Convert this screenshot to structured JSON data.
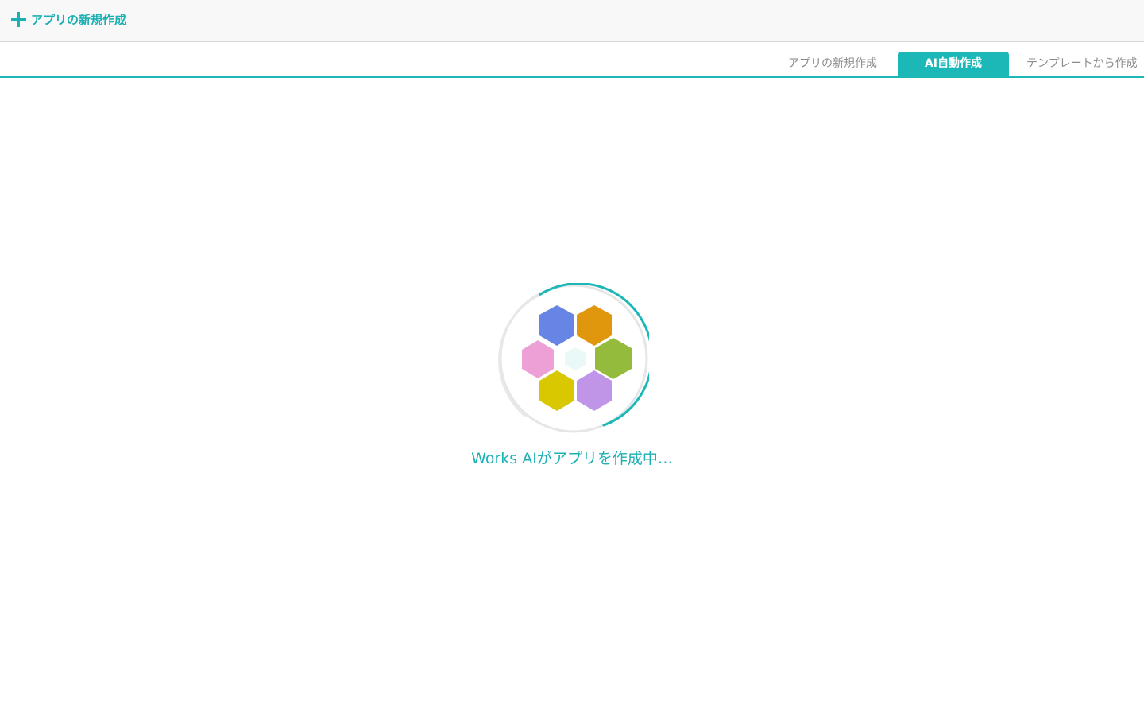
{
  "header": {
    "title": "アプリの新規作成",
    "icon": "plus-icon"
  },
  "tabs": [
    {
      "label": "アプリの新規作成",
      "active": false
    },
    {
      "label": "AI自動作成",
      "active": true
    },
    {
      "label": "テンプレートから作成",
      "active": false
    }
  ],
  "loader": {
    "status_text": "Works AIがアプリを作成中…",
    "hexagon_colors": [
      "#6685e4",
      "#e0960d",
      "#eca0d6",
      "#95bb3c",
      "#d9c800",
      "#c094e6",
      "#eaf8f8"
    ]
  },
  "colors": {
    "accent": "#1cb8b8",
    "header_bg": "#f8f8f8",
    "tab_inactive_text": "#8c8c8c"
  }
}
